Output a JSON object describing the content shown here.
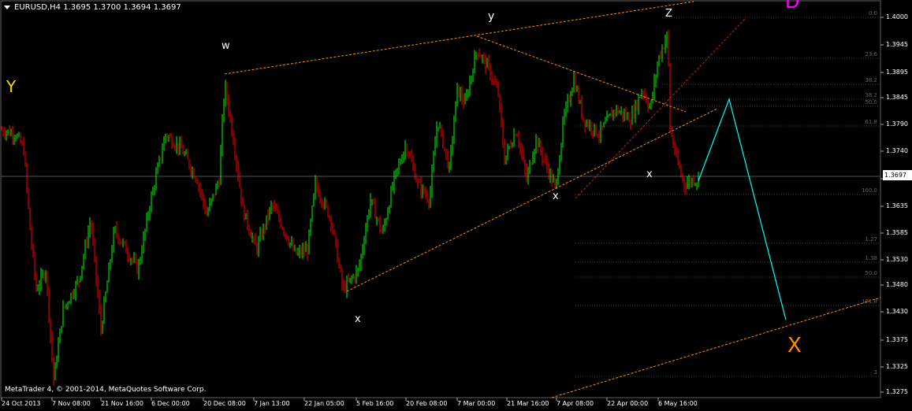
{
  "header": {
    "symbol_info": "EURUSD,H4  1.3695 1.3700 1.3694 1.3697"
  },
  "footer": {
    "copyright": "MetaTrader 4, © 2001-2014, MetaQuotes Software Corp."
  },
  "current_price": "1.3697",
  "wave_labels": [
    {
      "text": "Y",
      "color": "#ffd700"
    },
    {
      "text": "w",
      "color": "#ffffff"
    },
    {
      "text": "y",
      "color": "#ffffff"
    },
    {
      "text": "Z",
      "color": "#ffffff"
    },
    {
      "text": "x",
      "color": "#ffffff"
    },
    {
      "text": "x",
      "color": "#ffffff"
    },
    {
      "text": "x",
      "color": "#ffffff"
    },
    {
      "text": "X",
      "color": "#ff8c00"
    },
    {
      "text": "D",
      "color": "#ff00ff"
    }
  ],
  "fib_levels": [
    "0.0",
    "23.6",
    "38.2",
    "38.2",
    "50.0",
    "61.8",
    "100.0",
    "1.27",
    "1.38",
    "50.0",
    "161.8",
    "3"
  ],
  "colors": {
    "bull": "#00ff00",
    "bear": "#ff0000",
    "grid": "#3a3a3a",
    "trendline": "#ff8c00",
    "projection": "#00ffff",
    "background": "#000000"
  },
  "chart_data": {
    "type": "candlestick",
    "title": "EURUSD,H4",
    "y_ticks": [
      "1.4000",
      "1.3945",
      "1.3895",
      "1.3845",
      "1.3790",
      "1.3740",
      "1.3685",
      "1.3635",
      "1.3585",
      "1.3530",
      "1.3480",
      "1.3430",
      "1.3375",
      "1.3325",
      "1.3275"
    ],
    "x_ticks": [
      "24 Oct 2013",
      "7 Nov 08:00",
      "21 Nov 16:00",
      "6 Dec 00:00",
      "20 Dec 08:00",
      "7 Jan 13:00",
      "22 Jan 05:00",
      "5 Feb 16:00",
      "20 Feb 08:00",
      "7 Mar 00:00",
      "21 Mar 16:00",
      "7 Apr 08:00",
      "22 Apr 00:00",
      "6 May 16:00"
    ],
    "ylim": [
      1.3265,
      1.4045
    ],
    "grid": false,
    "price_path": [
      [
        0,
        1.38
      ],
      [
        20,
        1.379
      ],
      [
        30,
        1.376
      ],
      [
        38,
        1.36
      ],
      [
        46,
        1.348
      ],
      [
        58,
        1.352
      ],
      [
        68,
        1.33
      ],
      [
        80,
        1.344
      ],
      [
        100,
        1.35
      ],
      [
        115,
        1.362
      ],
      [
        128,
        1.34
      ],
      [
        145,
        1.36
      ],
      [
        160,
        1.356
      ],
      [
        175,
        1.352
      ],
      [
        190,
        1.365
      ],
      [
        210,
        1.379
      ],
      [
        230,
        1.376
      ],
      [
        250,
        1.37
      ],
      [
        262,
        1.363
      ],
      [
        278,
        1.37
      ],
      [
        285,
        1.389
      ],
      [
        296,
        1.378
      ],
      [
        308,
        1.364
      ],
      [
        325,
        1.356
      ],
      [
        345,
        1.365
      ],
      [
        360,
        1.36
      ],
      [
        375,
        1.355
      ],
      [
        390,
        1.356
      ],
      [
        400,
        1.369
      ],
      [
        420,
        1.362
      ],
      [
        435,
        1.348
      ],
      [
        455,
        1.352
      ],
      [
        470,
        1.366
      ],
      [
        485,
        1.359
      ],
      [
        500,
        1.37
      ],
      [
        515,
        1.377
      ],
      [
        530,
        1.369
      ],
      [
        545,
        1.366
      ],
      [
        555,
        1.382
      ],
      [
        570,
        1.372
      ],
      [
        580,
        1.388
      ],
      [
        590,
        1.385
      ],
      [
        605,
        1.396
      ],
      [
        620,
        1.392
      ],
      [
        632,
        1.387
      ],
      [
        640,
        1.374
      ],
      [
        655,
        1.38
      ],
      [
        668,
        1.37
      ],
      [
        680,
        1.378
      ],
      [
        695,
        1.372
      ],
      [
        705,
        1.368
      ],
      [
        715,
        1.382
      ],
      [
        728,
        1.39
      ],
      [
        740,
        1.382
      ],
      [
        760,
        1.379
      ],
      [
        780,
        1.384
      ],
      [
        800,
        1.382
      ],
      [
        815,
        1.388
      ],
      [
        825,
        1.384
      ],
      [
        835,
        1.394
      ],
      [
        847,
        1.399
      ],
      [
        850,
        1.38
      ],
      [
        858,
        1.374
      ],
      [
        868,
        1.369
      ],
      [
        880,
        1.37
      ],
      [
        886,
        1.3697
      ]
    ],
    "projection": [
      [
        886,
        1.3697
      ],
      [
        925,
        1.386
      ],
      [
        997,
        1.342
      ]
    ]
  }
}
